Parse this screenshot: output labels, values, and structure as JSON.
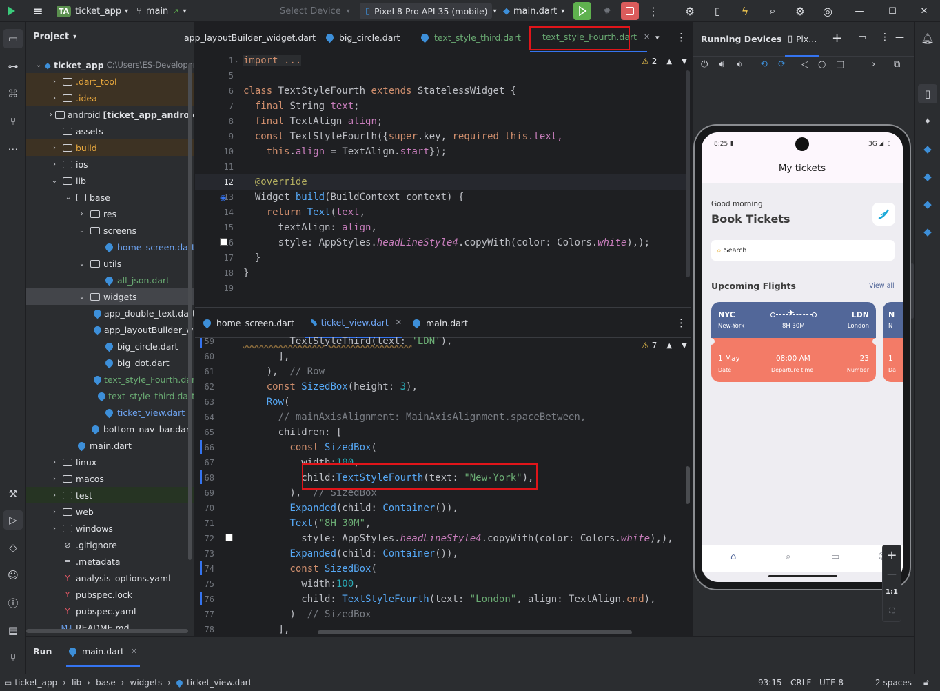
{
  "titlebar": {
    "app_badge": "TA",
    "project": "ticket_app",
    "branch": "main",
    "device_select": "Select Device",
    "device": "Pixel 8 Pro API 35 (mobile)",
    "run_config": "main.dart"
  },
  "project_panel": {
    "title": "Project",
    "tree": [
      {
        "label": "ticket_app",
        "extra": "C:\\Users\\ES-Developer",
        "depth": 0,
        "kind": "root",
        "open": true
      },
      {
        "label": ".dart_tool",
        "depth": 1,
        "kind": "folder",
        "color": "#e8a83e",
        "bg": "excluded"
      },
      {
        "label": ".idea",
        "depth": 1,
        "kind": "folder",
        "color": "#e8a83e",
        "bg": "excluded"
      },
      {
        "label": "android",
        "extra": "[ticket_app_android]",
        "depth": 1,
        "kind": "folder"
      },
      {
        "label": "assets",
        "depth": 1,
        "kind": "folder",
        "noarrow": true
      },
      {
        "label": "build",
        "depth": 1,
        "kind": "folder",
        "color": "#e8a83e",
        "bg": "excluded"
      },
      {
        "label": "ios",
        "depth": 1,
        "kind": "folder"
      },
      {
        "label": "lib",
        "depth": 1,
        "kind": "folder",
        "open": true
      },
      {
        "label": "base",
        "depth": 2,
        "kind": "folder",
        "open": true
      },
      {
        "label": "res",
        "depth": 3,
        "kind": "folder"
      },
      {
        "label": "screens",
        "depth": 3,
        "kind": "folder",
        "open": true
      },
      {
        "label": "home_screen.dart",
        "depth": 4,
        "kind": "dart",
        "color": "#6fa6f5"
      },
      {
        "label": "utils",
        "depth": 3,
        "kind": "folder",
        "open": true
      },
      {
        "label": "all_json.dart",
        "depth": 4,
        "kind": "dart",
        "color": "#6aab73"
      },
      {
        "label": "widgets",
        "depth": 3,
        "kind": "folder",
        "open": true,
        "bg": "selected"
      },
      {
        "label": "app_double_text.dart",
        "depth": 4,
        "kind": "dart"
      },
      {
        "label": "app_layoutBuilder_widget.dart",
        "depth": 4,
        "kind": "dart"
      },
      {
        "label": "big_circle.dart",
        "depth": 4,
        "kind": "dart"
      },
      {
        "label": "big_dot.dart",
        "depth": 4,
        "kind": "dart"
      },
      {
        "label": "text_style_Fourth.dart",
        "depth": 4,
        "kind": "dart",
        "color": "#6aab73"
      },
      {
        "label": "text_style_third.dart",
        "depth": 4,
        "kind": "dart",
        "color": "#6aab73"
      },
      {
        "label": "ticket_view.dart",
        "depth": 4,
        "kind": "dart",
        "color": "#6fa6f5"
      },
      {
        "label": "bottom_nav_bar.dart",
        "depth": 3,
        "kind": "dart"
      },
      {
        "label": "main.dart",
        "depth": 2,
        "kind": "dart"
      },
      {
        "label": "linux",
        "depth": 1,
        "kind": "folder"
      },
      {
        "label": "macos",
        "depth": 1,
        "kind": "folder"
      },
      {
        "label": "test",
        "depth": 1,
        "kind": "folder",
        "bg": "test"
      },
      {
        "label": "web",
        "depth": 1,
        "kind": "folder"
      },
      {
        "label": "windows",
        "depth": 1,
        "kind": "folder"
      },
      {
        "label": ".gitignore",
        "depth": 1,
        "kind": "file",
        "icon": "⊘"
      },
      {
        "label": ".metadata",
        "depth": 1,
        "kind": "file",
        "icon": "≡"
      },
      {
        "label": "analysis_options.yaml",
        "depth": 1,
        "kind": "file",
        "icon": "Y",
        "icon_color": "#e55765"
      },
      {
        "label": "pubspec.lock",
        "depth": 1,
        "kind": "file",
        "icon": "Y",
        "icon_color": "#e55765"
      },
      {
        "label": "pubspec.yaml",
        "depth": 1,
        "kind": "file",
        "icon": "Y",
        "icon_color": "#e55765"
      },
      {
        "label": "README.md",
        "depth": 1,
        "kind": "file",
        "icon": "M↓",
        "icon_color": "#6fa6f5"
      }
    ]
  },
  "editor1": {
    "tabs": [
      {
        "label": "app_layoutBuilder_widget.dart",
        "color": "#dfe1e5"
      },
      {
        "label": "big_circle.dart",
        "color": "#dfe1e5"
      },
      {
        "label": "text_style_third.dart",
        "color": "#6aab73"
      },
      {
        "label": "text_style_Fourth.dart",
        "color": "#6aab73",
        "active": true
      }
    ],
    "warnings": "2",
    "line_numbers": [
      "1",
      "5",
      "6",
      "7",
      "8",
      "9",
      "10",
      "11",
      "12",
      "13",
      "14",
      "15",
      "16",
      "17",
      "18",
      "19"
    ],
    "code": {
      "l1": "import ...",
      "l6a": "class ",
      "l6b": "TextStyleFourth ",
      "l6c": "extends ",
      "l6d": "StatelessWidget {",
      "l7a": "  final ",
      "l7b": "String ",
      "l7c": "text",
      "l8a": "  final ",
      "l8b": "TextAlign ",
      "l8c": "align",
      "l9a": "  const ",
      "l9b": "TextStyleFourth({",
      "l9c": "super",
      "l9d": ".key, ",
      "l9e": "required ",
      "l9f": "this",
      "l9g": ".text,",
      "l10a": "    this",
      "l10b": ".",
      "l10c": "align",
      "l10d": " = TextAlign.",
      "l10e": "start",
      "l10f": "});",
      "l12": "  @override",
      "l13a": "  Widget ",
      "l13b": "build",
      "l13c": "(BuildContext context) {",
      "l14a": "    return ",
      "l14b": "Text",
      "l14c": "(",
      "l14d": "text",
      "l15a": "      textAlign: ",
      "l15b": "align",
      "l16a": "      style: AppStyles.",
      "l16b": "headLineStyle4",
      "l16c": ".copyWith(color: Colors.",
      "l16d": "white",
      "l16e": "),);",
      "l17": "  }",
      "l18": "}"
    }
  },
  "editor2": {
    "tabs": [
      {
        "label": "home_screen.dart"
      },
      {
        "label": "ticket_view.dart",
        "active": true
      },
      {
        "label": "main.dart"
      }
    ],
    "warnings": "7",
    "line_numbers": [
      "59",
      "60",
      "61",
      "62",
      "63",
      "64",
      "65",
      "66",
      "67",
      "68",
      "69",
      "70",
      "71",
      "72",
      "73",
      "74",
      "75",
      "76",
      "77",
      "78"
    ],
    "code": {
      "l59a": "        TextStyleThird(text: ",
      "l59b": "'LDN'",
      "l59c": "),",
      "l60": "      ],",
      "l61a": "    ),  ",
      "l61b": "// Row",
      "l62a": "    const ",
      "l62b": "SizedBox",
      "l62c": "(height: ",
      "l62d": "3",
      "l62e": "),",
      "l63a": "    ",
      "l63b": "Row",
      "l63c": "(",
      "l64": "      // mainAxisAlignment: MainAxisAlignment.spaceBetween,",
      "l65": "      children: [",
      "l66a": "        const ",
      "l66b": "SizedBox",
      "l66c": "(",
      "l67a": "          width:",
      "l67b": "100",
      "l68a": "          child:",
      "l68b": "TextStyleFourth",
      "l68c": "(text: ",
      "l68d": "\"New-York\"",
      "l68e": "),",
      "l69a": "        ),  ",
      "l69b": "// SizedBox",
      "l70a": "        ",
      "l70b": "Expanded",
      "l70c": "(child: ",
      "l70d": "Container",
      "l70e": "()),",
      "l71a": "        ",
      "l71b": "Text",
      "l71c": "(",
      "l71d": "\"8H 30M\"",
      "l71e": ",",
      "l72a": "          style: AppStyles.",
      "l72b": "headLineStyle4",
      "l72c": ".copyWith(color: Colors.",
      "l72d": "white",
      "l72e": "),),  //",
      "l73a": "        ",
      "l73b": "Expanded",
      "l73c": "(child: ",
      "l73d": "Container",
      "l73e": "()),",
      "l74a": "        const ",
      "l74b": "SizedBox",
      "l74c": "(",
      "l75a": "          width:",
      "l75b": "100",
      "l76a": "          child: ",
      "l76b": "TextStyleFourth",
      "l76c": "(text: ",
      "l76d": "\"London\"",
      "l76e": ", align: TextAlign.",
      "l76f": "end",
      "l76g": "),",
      "l77a": "        )  ",
      "l77b": "// SizedBox",
      "l78": "      ],"
    }
  },
  "running": {
    "title": "Running Devices",
    "device_tab": "Pix...",
    "zoom_ratio": "1:1"
  },
  "phone": {
    "time": "8:25",
    "network": "3G",
    "app_title": "My tickets",
    "greeting": "Good morning",
    "headline": "Book Tickets",
    "search": "Search",
    "section": "Upcoming Flights",
    "view_all": "View all",
    "ticket": {
      "from_code": "NYC",
      "to_code": "LDN",
      "from_name": "New-York",
      "to_name": "London",
      "duration": "8H 30M",
      "date": "1 May",
      "date_label": "Date",
      "time": "08:00 AM",
      "time_label": "Departure time",
      "number": "23",
      "number_label": "Number"
    },
    "ticket2": {
      "code": "N",
      "name": "N",
      "date": "1",
      "date_label": "Da"
    }
  },
  "bottom": {
    "tab_run": "Run",
    "tab_file": "main.dart"
  },
  "status": {
    "crumbs": [
      "ticket_app",
      "lib",
      "base",
      "widgets",
      "ticket_view.dart"
    ],
    "position": "93:15",
    "line_sep": "CRLF",
    "encoding": "UTF-8",
    "indent": "2 spaces"
  },
  "colors": {
    "accent": "#3574f0",
    "red_box": "#e0151a",
    "run_green": "#5fb14e",
    "stop_red": "#db5c5c",
    "ticket_blue": "#526799",
    "ticket_orange": "#f37b67"
  }
}
